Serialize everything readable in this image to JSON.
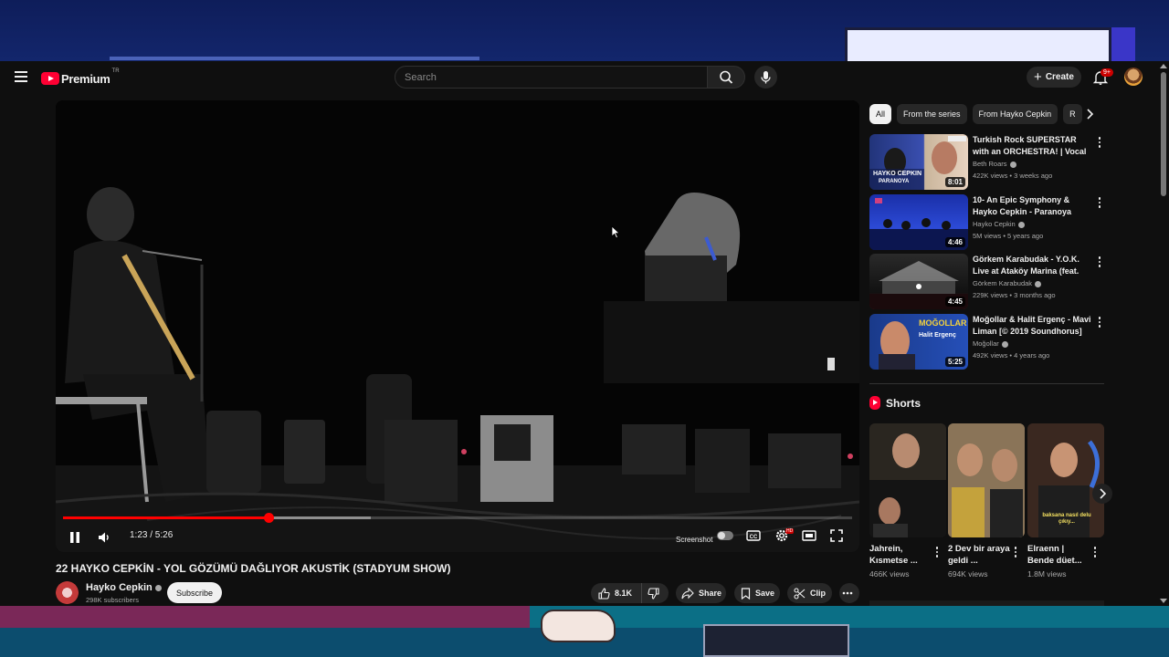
{
  "masthead": {
    "brand": "Premium",
    "country_code": "TR",
    "search_placeholder": "Search",
    "create_label": "Create",
    "notification_count": "9+"
  },
  "player": {
    "time_display": "1:23 / 5:26",
    "progress_played": 0.26,
    "progress_loaded": 0.39,
    "screenshot_label": "Screenshot",
    "hd_badge": "HD"
  },
  "video": {
    "title": "22 HAYKO CEPKİN - YOL GÖZÜMÜ DAĞLIYOR AKUSTİK (STADYUM SHOW)",
    "channel": "Hayko Cepkin",
    "subscribers": "298K subscribers",
    "subscribe_label": "Subscribe",
    "likes": "8.1K",
    "share_label": "Share",
    "save_label": "Save",
    "clip_label": "Clip"
  },
  "chips": [
    "All",
    "From the series",
    "From Hayko Cepkin",
    "R"
  ],
  "recommendations": [
    {
      "title": "Turkish Rock SUPERSTAR with an ORCHESTRA! | Vocal Coach...",
      "channel": "Beth Roars",
      "meta": "422K views • 3 weeks ago",
      "duration": "8:01",
      "thumb_text": "HAYKO CEPKIN",
      "thumb_sub": "PARANOYA"
    },
    {
      "title": "10- An Epic Symphony & Hayko Cepkin - Paranoya",
      "channel": "Hayko Cepkin",
      "meta": "5M views • 5 years ago",
      "duration": "4:46"
    },
    {
      "title": "Görkem Karabudak - Y.O.K. Live at Ataköy Marina (feat. Burak ...",
      "channel": "Görkem Karabudak",
      "meta": "229K views • 3 months ago",
      "duration": "4:45"
    },
    {
      "title": "Moğollar & Halit Ergenç - Mavi Liman [© 2019 Soundhorus]",
      "channel": "Moğollar",
      "meta": "492K views • 4 years ago",
      "duration": "5:25",
      "thumb_text": "MOĞOLLAR",
      "thumb_sub": "Halit Ergenç"
    }
  ],
  "shorts": {
    "heading": "Shorts",
    "items": [
      {
        "title": "Jahrein, Kısmetse ...",
        "views": "466K views"
      },
      {
        "title": "2 Dev bir araya geldi ...",
        "views": "694K views"
      },
      {
        "title": "Elraenn | Bende düet...",
        "views": "1.8M views",
        "caption": "baksana nasıl delu çıkıy..."
      }
    ]
  },
  "colors": {
    "brand_red": "#ff0033",
    "progress_red": "#ff0000",
    "background": "#0f0f0f",
    "chip_bg": "#272727"
  }
}
